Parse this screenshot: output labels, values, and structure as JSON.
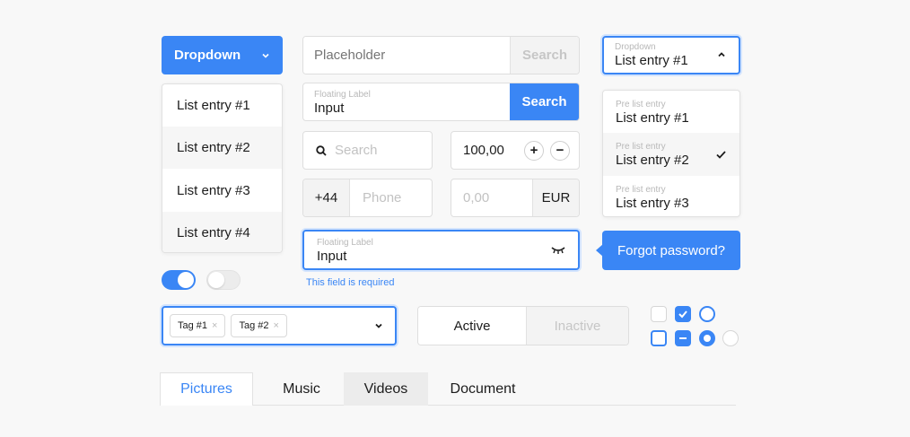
{
  "colors": {
    "accent": "#3a86f5",
    "border": "#dedede",
    "placeholder": "#c2c2c2",
    "error": "#3a86f5"
  },
  "dropdown": {
    "label": "Dropdown",
    "icon": "chevron-down-icon"
  },
  "dropdown_list": [
    "List entry #1",
    "List entry #2",
    "List entry #3",
    "List entry #4"
  ],
  "search_bar": {
    "placeholder": "Placeholder",
    "button": "Search"
  },
  "float_search": {
    "label": "Floating Label",
    "value": "Input",
    "button": "Search"
  },
  "search_field": {
    "placeholder": "Search",
    "icon": "search-icon"
  },
  "stepper": {
    "value": "100,00",
    "plus": "+",
    "minus": "−"
  },
  "phone": {
    "prefix": "+44",
    "placeholder": "Phone"
  },
  "currency": {
    "placeholder": "0,00",
    "unit": "EUR"
  },
  "password": {
    "label": "Floating Label",
    "value": "Input",
    "icon": "eye-closed-icon",
    "error": "This field is required"
  },
  "forgot": {
    "label": "Forgot password?"
  },
  "select": {
    "label": "Dropdown",
    "value": "List entry #1",
    "icon": "chevron-up-icon"
  },
  "select_list": [
    {
      "label": "Pre list entry",
      "value": "List entry #1",
      "checked": false
    },
    {
      "label": "Pre list entry",
      "value": "List entry #2",
      "checked": true
    },
    {
      "label": "Pre list entry",
      "value": "List entry #3",
      "checked": false
    }
  ],
  "toggles": [
    {
      "state": "on"
    },
    {
      "state": "off"
    }
  ],
  "tags": {
    "items": [
      "Tag #1",
      "Tag #2"
    ],
    "remove": "×"
  },
  "segmented": {
    "active": "Active",
    "inactive": "Inactive"
  },
  "tabs": [
    "Pictures",
    "Music",
    "Videos",
    "Document"
  ],
  "selected_tab": "Pictures"
}
